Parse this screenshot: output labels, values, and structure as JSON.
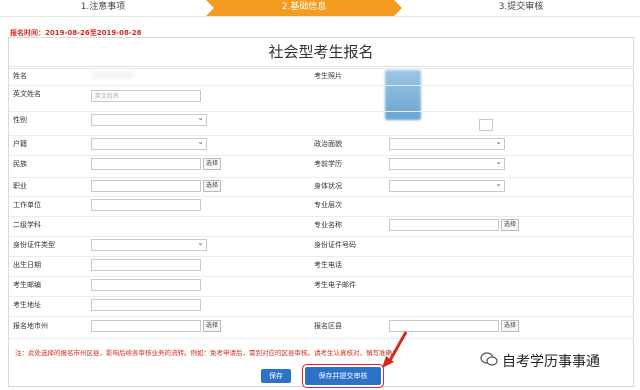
{
  "steps": {
    "s1": "1.注意事项",
    "s2": "2.基础信息",
    "s3": "3.提交审核"
  },
  "reg_time": "报名时间：2019-08-26至2019-08-28",
  "form": {
    "title": "社会型考生报名",
    "labels": {
      "name": "姓名",
      "photo": "考生照片",
      "english_name": "英文姓名",
      "gender": "性别",
      "hukou": "户籍",
      "politics": "政治面貌",
      "ethnic": "民族",
      "edu": "考前学历",
      "job": "职业",
      "health": "身体状况",
      "work_unit": "工作单位",
      "level": "专业层次",
      "second_major": "二级学科",
      "major_name": "专业名称",
      "id_type": "身份证件类型",
      "id_no": "身份证件号码",
      "birth": "出生日期",
      "phone": "考生电话",
      "postcode": "考生邮编",
      "email": "考生电子邮件",
      "address": "考生地址",
      "reg_city": "报名地市州",
      "reg_district": "报名区县"
    },
    "placeholder_english": "英文姓名",
    "choose": "选择"
  },
  "note": "注：此处选择的报名市州区县，影响后续各审核业务的流转。例如：免考申请后，需到对应的区县审核。请考生认真核对，慎写准确！",
  "buttons": {
    "save": "保存",
    "submit": "保存并提交审核"
  },
  "watermark": "自考学历事事通"
}
